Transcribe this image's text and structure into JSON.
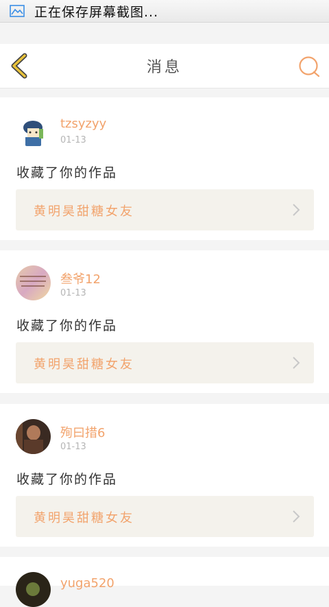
{
  "status_bar": {
    "text": "正在保存屏幕截图..."
  },
  "nav": {
    "title": "消息"
  },
  "notifications": [
    {
      "username": "tzsyzyy",
      "date": "01-13",
      "message": "收藏了你的作品",
      "work_title": "黄明昊甜糖女友"
    },
    {
      "username": "叁爷12",
      "date": "01-13",
      "message": "收藏了你的作品",
      "work_title": "黄明昊甜糖女友"
    },
    {
      "username": "殉曰措6",
      "date": "01-13",
      "message": "收藏了你的作品",
      "work_title": "黄明昊甜糖女友"
    },
    {
      "username": "yuga520"
    }
  ],
  "colors": {
    "accent": "#f2a36c",
    "back_arrow": "#e8c23a",
    "background": "#f4f4f4"
  }
}
